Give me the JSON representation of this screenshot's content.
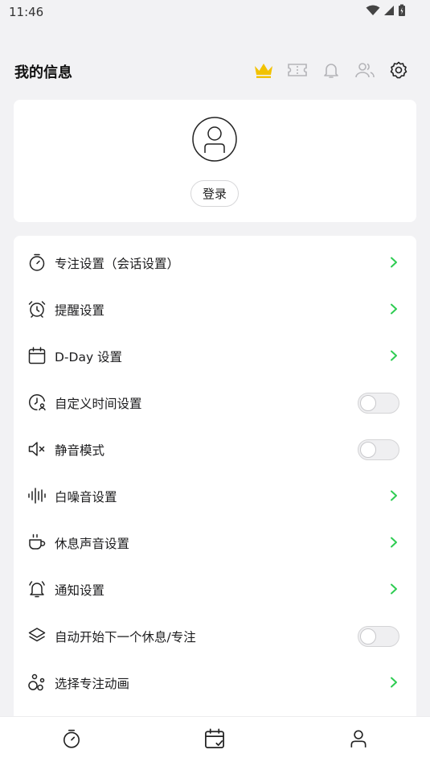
{
  "status_bar": {
    "time": "11:46"
  },
  "header": {
    "title": "我的信息",
    "actions": [
      "crown-icon",
      "ticket-icon",
      "bell-icon",
      "users-icon",
      "gear-icon"
    ]
  },
  "profile": {
    "login_label": "登录"
  },
  "settings": {
    "items": [
      {
        "label": "专注设置（会话设置）",
        "icon": "stopwatch-icon",
        "control": "chevron"
      },
      {
        "label": "提醒设置",
        "icon": "alarm-clock-icon",
        "control": "chevron"
      },
      {
        "label": "D-Day 设置",
        "icon": "calendar-icon",
        "control": "chevron"
      },
      {
        "label": "自定义时间设置",
        "icon": "clock-user-icon",
        "control": "toggle",
        "on": false
      },
      {
        "label": "静音模式",
        "icon": "speaker-mute-icon",
        "control": "toggle",
        "on": false
      },
      {
        "label": "白噪音设置",
        "icon": "sound-wave-icon",
        "control": "chevron"
      },
      {
        "label": "休息声音设置",
        "icon": "coffee-cup-icon",
        "control": "chevron"
      },
      {
        "label": "通知设置",
        "icon": "notification-bell-icon",
        "control": "chevron"
      },
      {
        "label": "自动开始下一个休息/专注",
        "icon": "layers-icon",
        "control": "toggle",
        "on": false
      },
      {
        "label": "选择专注动画",
        "icon": "shapes-icon",
        "control": "chevron"
      }
    ]
  },
  "bottom_nav": [
    "timer-tab-icon",
    "calendar-check-tab-icon",
    "profile-tab-icon"
  ],
  "colors": {
    "accent": "#2ecc52",
    "crown": "#f2c200",
    "background": "#f2f2f4"
  }
}
